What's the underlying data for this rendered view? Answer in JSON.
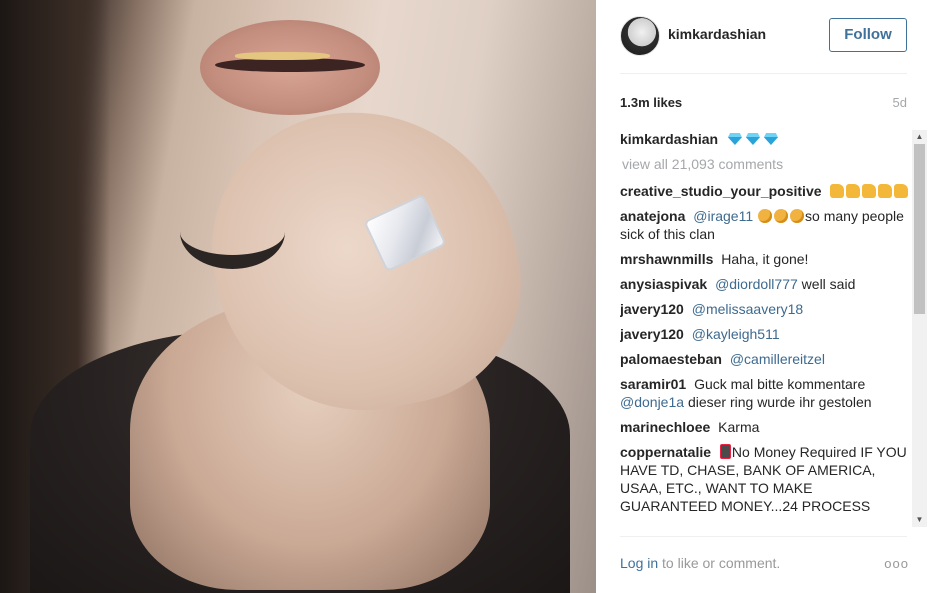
{
  "post": {
    "photo_alt": "Instagram photo"
  },
  "header": {
    "username": "kimkardashian",
    "follow_label": "Follow"
  },
  "stats": {
    "likes": "1.3m likes",
    "age": "5d"
  },
  "caption": {
    "username": "kimkardashian",
    "emoji": "gem-icon x3"
  },
  "view_all": "view all 21,093 comments",
  "comments": [
    {
      "user": "creative_studio_your_positive",
      "text": ""
    },
    {
      "user": "anatejona",
      "mention": "@irage11",
      "text": "so many people sick of this clan"
    },
    {
      "user": "mrshawnmills",
      "text": "Haha, it gone!"
    },
    {
      "user": "anysiaspivak",
      "mention": "@diordoll777",
      "text": "well said"
    },
    {
      "user": "javery120",
      "mention": "@melissaavery18",
      "text": ""
    },
    {
      "user": "javery120",
      "mention": "@kayleigh511",
      "text": ""
    },
    {
      "user": "palomaesteban",
      "mention": "@camillereitzel",
      "text": ""
    },
    {
      "user": "saramir01",
      "text_pre": "Guck mal bitte kommentare",
      "mention": "@donje1a",
      "text": "dieser ring wurde ihr gestolen"
    },
    {
      "user": "marinechloee",
      "text": "Karma"
    },
    {
      "user": "coppernatalie",
      "text": "No Money Required IF YOU HAVE TD, CHASE, BANK OF AMERICA, USAA, ETC., WANT TO MAKE GUARANTEED MONEY...24 PROCESS"
    }
  ],
  "footer": {
    "login": "Log in",
    "rest": "to like or comment.",
    "more": "ooo"
  }
}
